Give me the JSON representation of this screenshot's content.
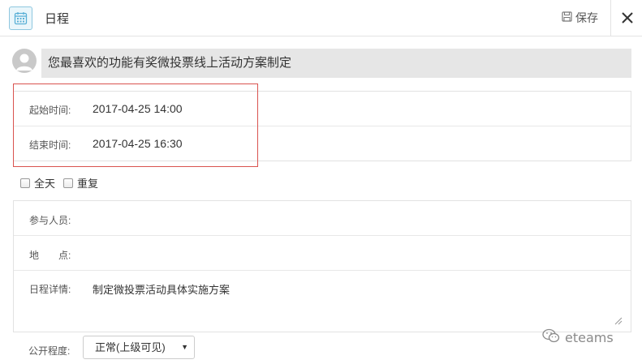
{
  "header": {
    "title": "日程",
    "save_label": "保存",
    "icons": {
      "calendar": "calendar-icon",
      "save": "floppy-disk-icon",
      "close": "close-icon"
    },
    "accent_color": "#7fc3e0"
  },
  "event": {
    "title": "您最喜欢的功能有奖微投票线上活动方案制定"
  },
  "times": {
    "start_label": "起始时间:",
    "start_value": "2017-04-25 14:00",
    "end_label": "结束时间:",
    "end_value": "2017-04-25 16:30"
  },
  "options": {
    "all_day_label": "全天",
    "all_day_checked": false,
    "repeat_label": "重复",
    "repeat_checked": false
  },
  "details": {
    "participants_label": "参与人员:",
    "participants_value": "",
    "location_label": "地　　点:",
    "location_value": "",
    "description_label": "日程详情:",
    "description_value": "制定微投票活动具体实施方案"
  },
  "visibility": {
    "label": "公开程度:",
    "selected": "正常(上级可见)"
  },
  "watermark": {
    "text": "eteams",
    "icon": "wechat-icon"
  },
  "colors": {
    "highlight_border": "#d9534f",
    "title_bar_bg": "#e6e6e6"
  }
}
